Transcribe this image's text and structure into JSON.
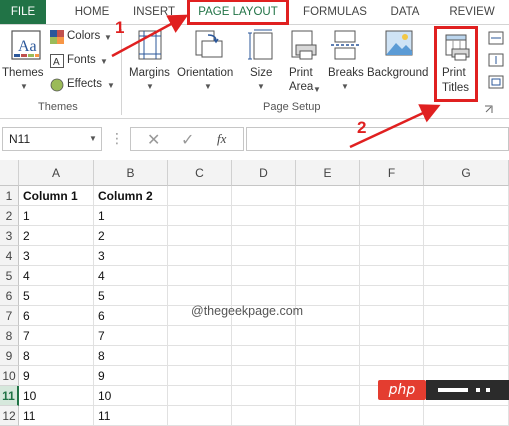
{
  "tabs": [
    "FILE",
    "HOME",
    "INSERT",
    "PAGE LAYOUT",
    "FORMULAS",
    "DATA",
    "REVIEW"
  ],
  "themes": {
    "themes_label": "Themes",
    "colors_label": "Colors",
    "fonts_label": "Fonts",
    "effects_label": "Effects",
    "group_label": "Themes"
  },
  "page_setup": {
    "margins": "Margins",
    "orientation": "Orientation",
    "size": "Size",
    "print_area_line1": "Print",
    "print_area_line2": "Area",
    "breaks": "Breaks",
    "background": "Background",
    "print_titles_line1": "Print",
    "print_titles_line2": "Titles",
    "group_label": "Page Setup"
  },
  "annotations": {
    "step1": "1",
    "step2": "2"
  },
  "formula_bar": {
    "name_box": "N11",
    "fx_symbol": "fx",
    "formula": ""
  },
  "grid": {
    "columns": [
      "A",
      "B",
      "C",
      "D",
      "E",
      "F",
      "G"
    ],
    "rows": [
      "1",
      "2",
      "3",
      "4",
      "5",
      "6",
      "7",
      "8",
      "9",
      "10",
      "11",
      "12"
    ],
    "selected_row": "11",
    "cells": [
      [
        "Column 1",
        "Column 2"
      ],
      [
        "1",
        "1"
      ],
      [
        "2",
        "2"
      ],
      [
        "3",
        "3"
      ],
      [
        "4",
        "4"
      ],
      [
        "5",
        "5"
      ],
      [
        "6",
        "6"
      ],
      [
        "7",
        "7"
      ],
      [
        "8",
        "8"
      ],
      [
        "9",
        "9"
      ],
      [
        "10",
        "10"
      ],
      [
        "11",
        "11"
      ]
    ]
  },
  "watermark": "@thegeekpage.com",
  "php_badge": "php",
  "colors": {
    "excel_green": "#217346",
    "callout_red": "#e02020"
  }
}
